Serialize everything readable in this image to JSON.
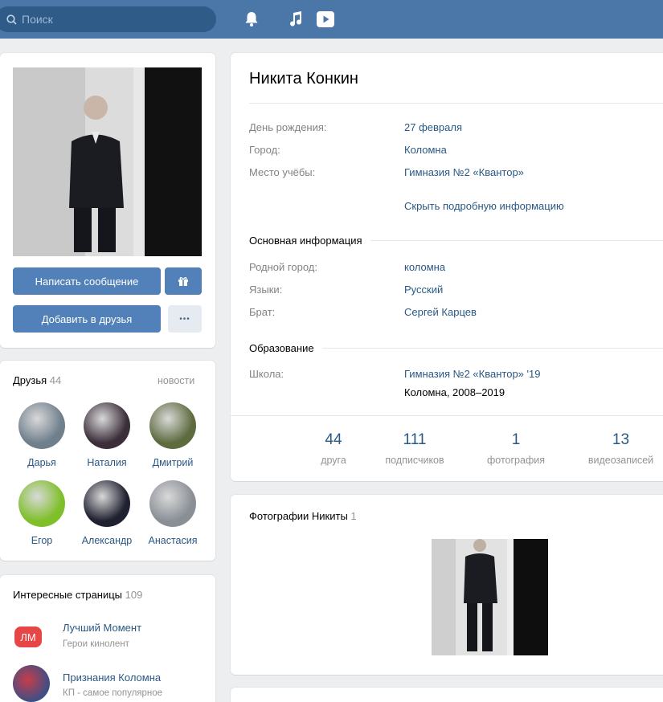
{
  "header": {
    "search_placeholder": "Поиск",
    "icons": [
      "search-icon",
      "bell-icon",
      "music-icon",
      "video-play-icon"
    ]
  },
  "profile_card": {
    "message_button": "Написать сообщение",
    "gift_icon": "gift-icon",
    "add_friend_button": "Добавить в друзья",
    "more_button": "•••"
  },
  "friends": {
    "title": "Друзья",
    "count": "44",
    "news_link": "новости",
    "items": [
      {
        "name": "Дарья",
        "color": "#6f7f8c"
      },
      {
        "name": "Наталия",
        "color": "#3b2e3a"
      },
      {
        "name": "Дмитрий",
        "color": "#5e6b3f"
      },
      {
        "name": "Егор",
        "color": "#7fbf2a"
      },
      {
        "name": "Александр",
        "color": "#1f2030"
      },
      {
        "name": "Анастасия",
        "color": "#8a8f96"
      }
    ]
  },
  "interesting": {
    "title": "Интересные страницы",
    "count": "109",
    "items": [
      {
        "badge": "ЛМ",
        "name": "Лучший Момент",
        "sub": "Герои кинолент"
      },
      {
        "name": "Признания Коломна",
        "sub": "КП - самое популярное"
      }
    ]
  },
  "info": {
    "name": "Никита Конкин",
    "rows": [
      {
        "label": "День рождения:",
        "value": "27 февраля"
      },
      {
        "label": "Город:",
        "value": "Коломна"
      },
      {
        "label": "Место учёбы:",
        "value": "Гимназия №2 «Квантор»"
      }
    ],
    "hide_link": "Скрыть подробную информацию",
    "main_section": "Основная информация",
    "main_rows": [
      {
        "label": "Родной город:",
        "value": "коломна"
      },
      {
        "label": "Языки:",
        "value": "Русский"
      },
      {
        "label": "Брат:",
        "value": "Сергей Карцев"
      }
    ],
    "edu_section": "Образование",
    "school_label": "Школа:",
    "school_value": "Гимназия №2 «Квантор» '19",
    "school_sub": "Коломна, 2008–2019"
  },
  "counters": [
    {
      "num": "44",
      "label": "друга"
    },
    {
      "num": "111",
      "label": "подписчиков"
    },
    {
      "num": "1",
      "label": "фотография"
    },
    {
      "num": "13",
      "label": "видеозаписей"
    }
  ],
  "photos": {
    "title": "Фотографии Никиты",
    "count": "1"
  }
}
